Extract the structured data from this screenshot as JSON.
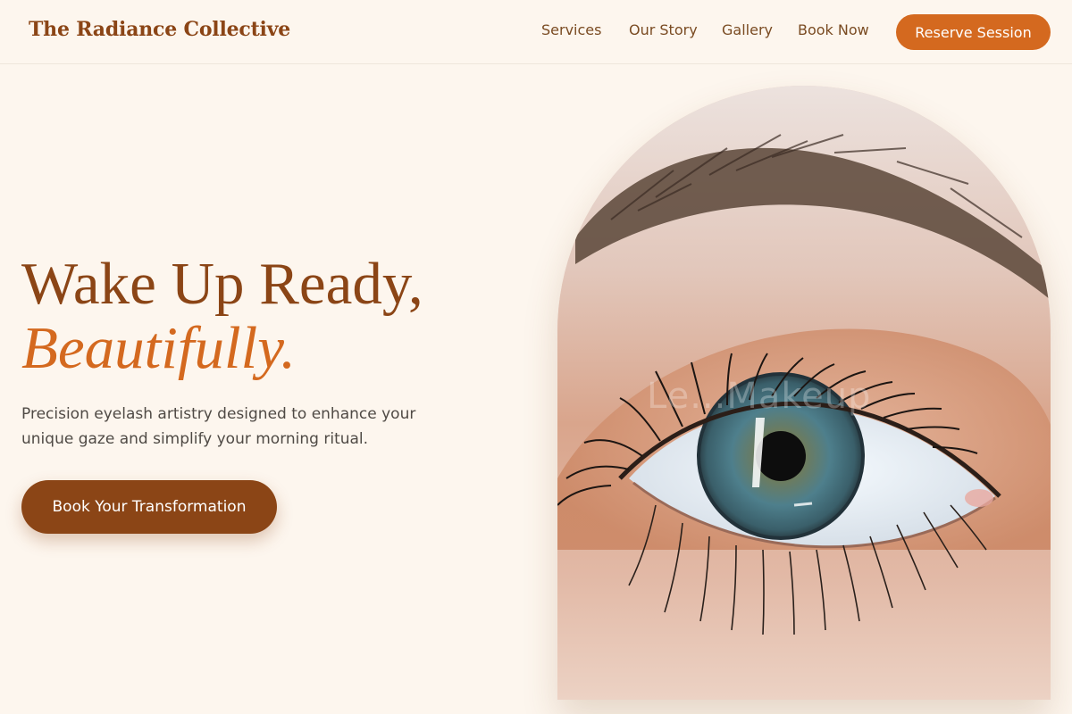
{
  "header": {
    "brand": "The Radiance Collective",
    "nav": [
      {
        "label": "Services"
      },
      {
        "label": "Our Story"
      },
      {
        "label": "Gallery"
      },
      {
        "label": "Book Now"
      }
    ],
    "cta_label": "Reserve Session"
  },
  "hero": {
    "title_line1": "Wake Up Ready,",
    "title_line2": "Beautifully.",
    "subtitle": "Precision eyelash artistry designed to enhance your unique gaze and simplify your morning ritual.",
    "cta_label": "Book Your Transformation"
  },
  "image": {
    "watermark": "Le...Makeup"
  },
  "colors": {
    "background": "#fdf6ee",
    "brand_brown": "#8b4516",
    "accent_orange": "#d4691f",
    "iris_blue": "#4e7f8c"
  }
}
